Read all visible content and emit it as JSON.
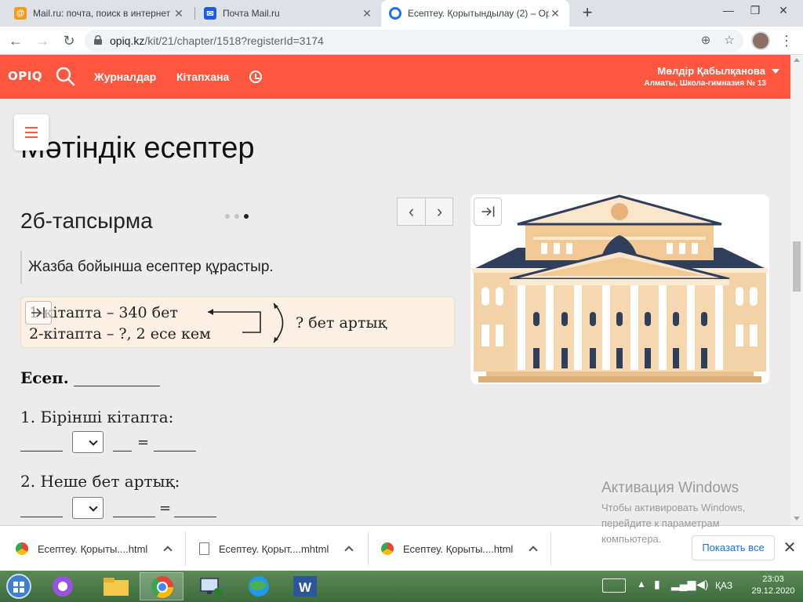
{
  "browser": {
    "tabs": [
      {
        "title": "Mail.ru: почта, поиск в интернет",
        "color": "#f59b1c"
      },
      {
        "title": "Почта Mail.ru",
        "color": "#1b5fe0"
      },
      {
        "title": "Есептеу. Қорытындылау (2) – Op",
        "color": "#1a73e8",
        "active": true
      }
    ],
    "new_tab_glyph": "+",
    "url_host": "opiq.kz",
    "url_path": "/kit/21/chapter/1518?registerId=3174"
  },
  "site": {
    "logo": "OPIQ",
    "nav": [
      "Журналдар",
      "Кітапхана"
    ],
    "user_name": "Мөлдір Қабылқанова",
    "user_school": "Алматы, Школа-гимназия № 13",
    "accent": "#ff5640"
  },
  "page": {
    "title": "Мәтіндік есептер",
    "task_title": "2б-тапсырма",
    "instruction": "Жазба бойынша есептер құрастыр.",
    "scheme": {
      "line1": "1-кітапта – 340 бет",
      "line2": "2-кітапта – ?, 2 есе кем",
      "question": "? бет артық"
    },
    "esep_label": "Есеп.",
    "questions": [
      {
        "label": "1. Бірінші кітапта:",
        "equals": "="
      },
      {
        "label": "2. Неше бет артық:",
        "equals": "="
      }
    ],
    "pager": {
      "prev": "‹",
      "next": "›"
    }
  },
  "watermark": {
    "title": "Активация Windows",
    "text": "Чтобы активировать Windows, перейдите к параметрам компьютера."
  },
  "downloads": {
    "items": [
      "Есептеу. Қорыты....html",
      "Есептеу. Қорыт....mhtml",
      "Есептеу. Қорыты....html"
    ],
    "show_all": "Показать все"
  },
  "taskbar": {
    "lang": "ҚАЗ",
    "time": "23:03",
    "date": "29.12.2020"
  }
}
